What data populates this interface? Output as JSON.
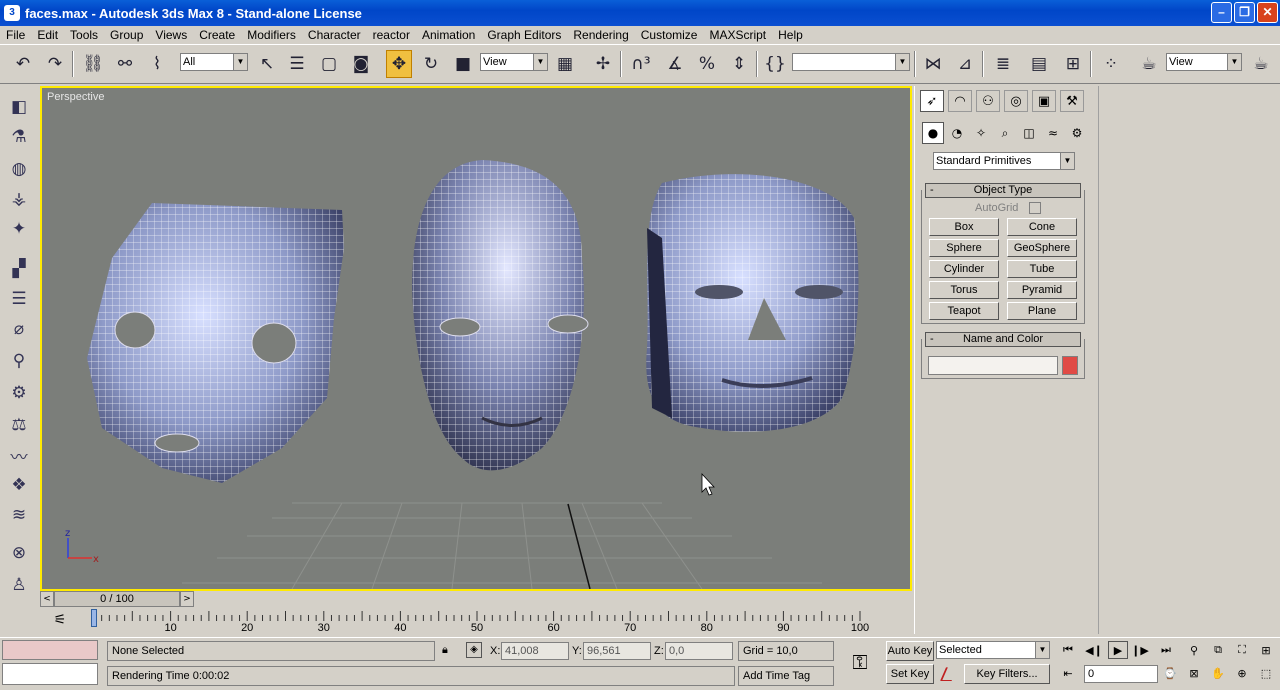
{
  "window": {
    "title": "faces.max - Autodesk 3ds Max 8  - Stand-alone License",
    "minimize": "–",
    "maximize": "❐",
    "close": "✕"
  },
  "menu": [
    "File",
    "Edit",
    "Tools",
    "Group",
    "Views",
    "Create",
    "Modifiers",
    "Character",
    "reactor",
    "Animation",
    "Graph Editors",
    "Rendering",
    "Customize",
    "MAXScript",
    "Help"
  ],
  "toolbar": {
    "selection_filter": "All",
    "ref_coord": "View",
    "named_selection": "",
    "render_view": "View",
    "icons": [
      "undo-icon",
      "redo-icon",
      "select-link-icon",
      "unlink-icon",
      "bind-space-warp-icon",
      "select-object-icon",
      "select-by-name-icon",
      "rect-region-icon",
      "window-crossing-icon",
      "move-icon",
      "rotate-icon",
      "scale-icon",
      "use-pivot-icon",
      "manipulate-icon",
      "snap-3-icon",
      "angle-snap-icon",
      "percent-snap-icon",
      "spinner-snap-icon",
      "edit-named-sets-icon",
      "mirror-icon",
      "align-icon",
      "layer-manager-icon",
      "curve-editor-icon",
      "schematic-view-icon",
      "material-editor-icon",
      "render-scene-icon",
      "quick-render-icon"
    ]
  },
  "left_toolbar_icons": [
    "create-box-icon",
    "create-shape-icon",
    "sphere-icon",
    "light-icon",
    "helper-icon",
    "checker-icon",
    "stack-icon",
    "tube-icon",
    "brush-icon",
    "gear-icon",
    "bone-icon",
    "hose-icon",
    "cloth-icon",
    "wave-icon",
    "link-icon",
    "biped-icon",
    "paint-icon"
  ],
  "viewport": {
    "label": "Perspective",
    "axis_z": "z",
    "axis_x": "x"
  },
  "command_panel": {
    "tabs": [
      "create-tab-icon",
      "modify-tab-icon",
      "hierarchy-tab-icon",
      "motion-tab-icon",
      "display-tab-icon",
      "utilities-tab-icon"
    ],
    "subtabs": [
      "geometry-icon",
      "shapes-icon",
      "lights-icon",
      "cameras-icon",
      "helpers-icon",
      "spacewarps-icon",
      "systems-icon"
    ],
    "category": "Standard Primitives",
    "object_type_title": "Object Type",
    "autogrid": "AutoGrid",
    "buttons": [
      "Box",
      "Cone",
      "Sphere",
      "GeoSphere",
      "Cylinder",
      "Tube",
      "Torus",
      "Pyramid",
      "Teapot",
      "Plane"
    ],
    "name_color_title": "Name and Color",
    "name_value": "",
    "object_color": "#e04a45"
  },
  "timeline": {
    "frame": "0 / 100",
    "ticks": [
      "10",
      "20",
      "30",
      "40",
      "50",
      "60",
      "70",
      "80",
      "90",
      "100"
    ],
    "position": 0
  },
  "status": {
    "selection": "None Selected",
    "x_label": "X:",
    "x_value": "41,008",
    "y_label": "Y:",
    "y_value": "96,561",
    "z_label": "Z:",
    "z_value": "0,0",
    "grid": "Grid = 10,0",
    "render_time": "Rendering Time  0:00:02",
    "add_time_tag": "Add Time Tag",
    "auto_key": "Auto Key",
    "set_key": "Set Key",
    "key_mode": "Selected",
    "key_filters": "Key Filters...",
    "current_frame": "0"
  }
}
